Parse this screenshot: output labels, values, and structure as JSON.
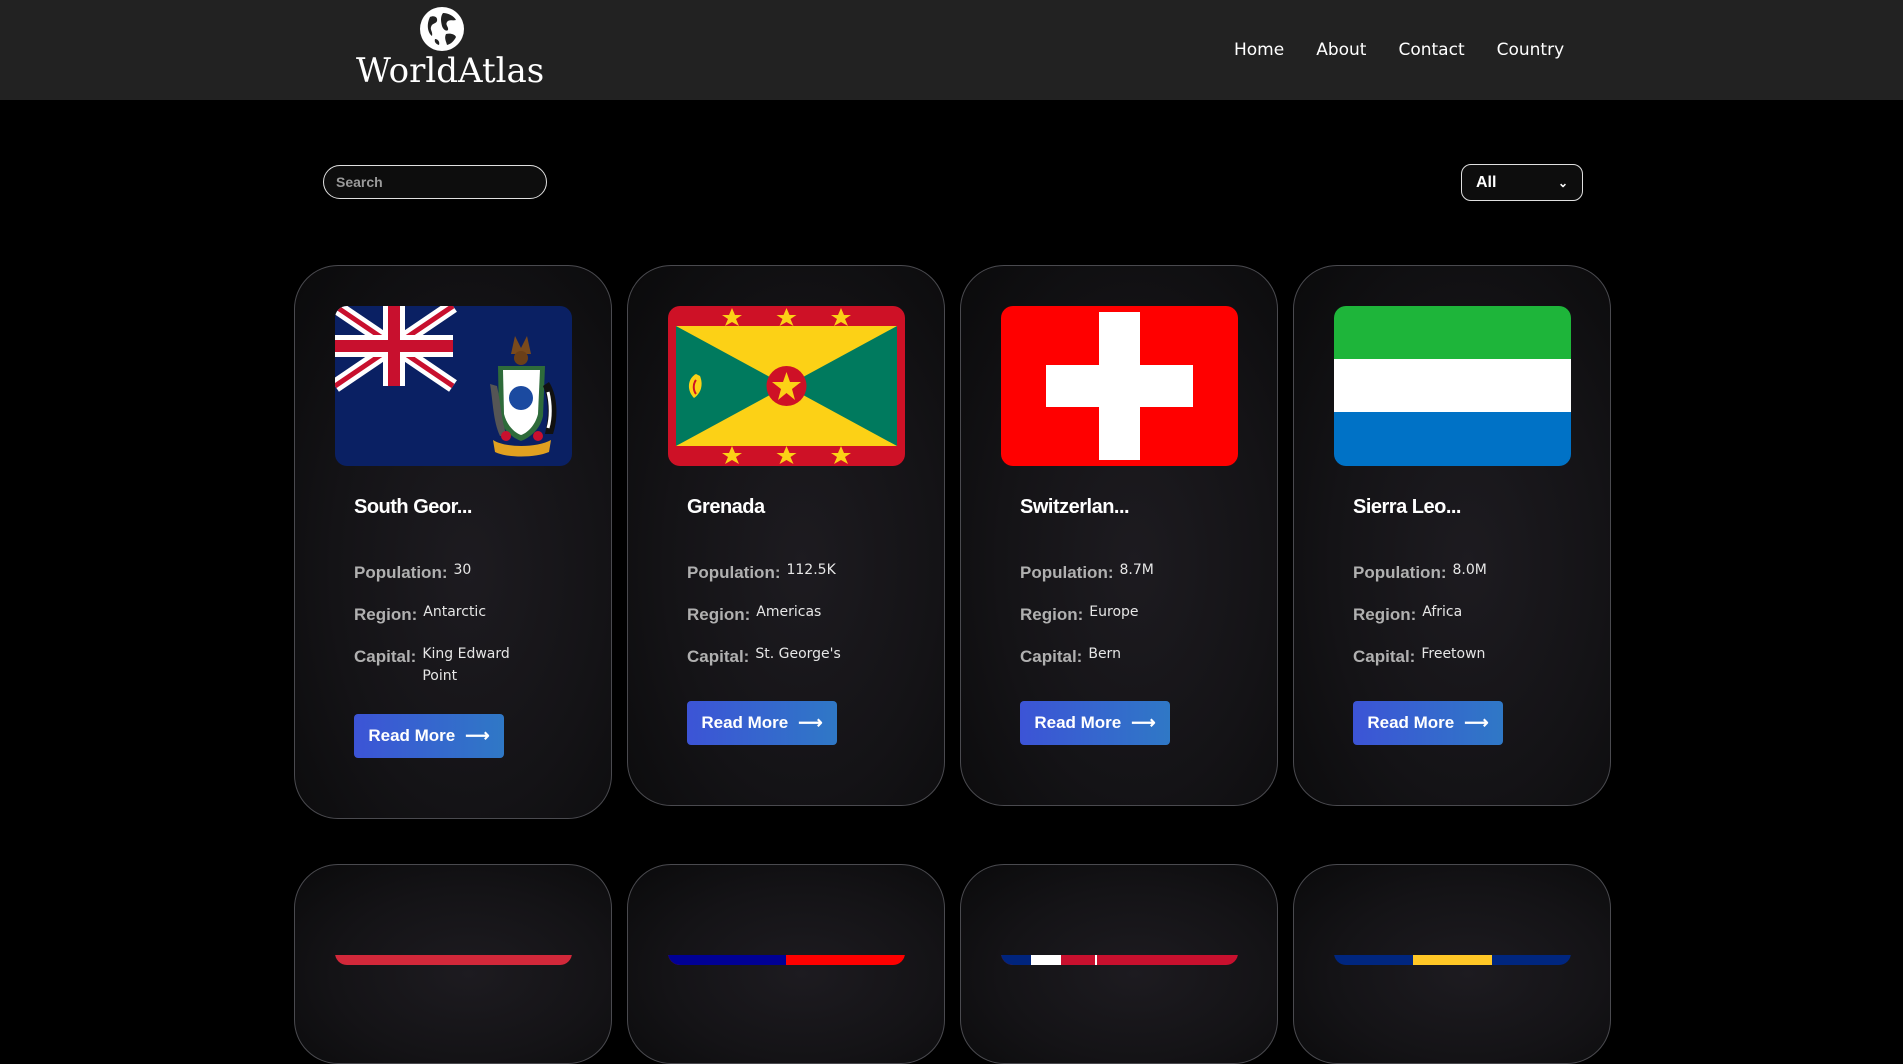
{
  "brand": {
    "name": "WorldAtlas",
    "icon": "globe-icon"
  },
  "nav": [
    "Home",
    "About",
    "Contact",
    "Country"
  ],
  "search": {
    "placeholder": "Search",
    "value": ""
  },
  "filter": {
    "selected": "All"
  },
  "labels": {
    "population": "Population:",
    "region": "Region:",
    "capital": "Capital:",
    "read_more": "Read More"
  },
  "countries": [
    {
      "name": "South Geor...",
      "population": "30",
      "region": "Antarctic",
      "capital": "King Edward Point",
      "flag": "south-georgia-flag"
    },
    {
      "name": "Grenada",
      "population": "112.5K",
      "region": "Americas",
      "capital": "St. George's",
      "flag": "grenada-flag"
    },
    {
      "name": "Switzerlan...",
      "population": "8.7M",
      "region": "Europe",
      "capital": "Bern",
      "flag": "switzerland-flag"
    },
    {
      "name": "Sierra Leo...",
      "population": "8.0M",
      "region": "Africa",
      "capital": "Freetown",
      "flag": "sierra-leone-flag"
    }
  ],
  "colors": {
    "button_start": "#3c54d6",
    "button_end": "#2f78c6",
    "header_bg": "#222222",
    "page_bg": "#000000"
  }
}
